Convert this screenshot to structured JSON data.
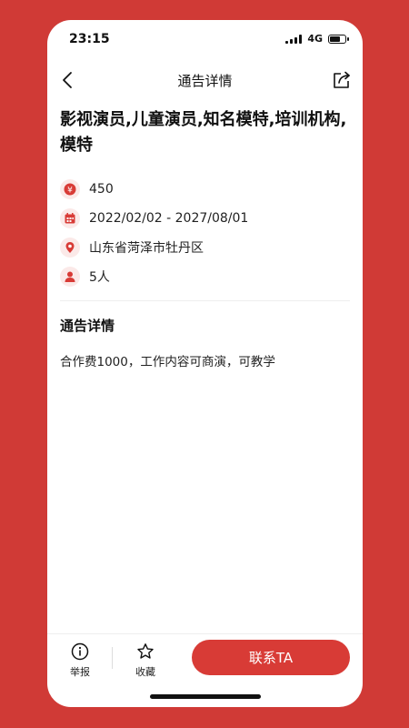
{
  "status_bar": {
    "time": "23:15",
    "network": "4G",
    "battery_level": 0.75
  },
  "navbar": {
    "title": "通告详情",
    "back_icon": "chevron-left-icon",
    "share_icon": "share-icon"
  },
  "notice": {
    "title": "影视演员,儿童演员,知名模特,培训机构,模特",
    "fee": "450",
    "date_range": "2022/02/02 - 2027/08/01",
    "location": "山东省菏泽市牡丹区",
    "headcount": "5人",
    "detail_heading": "通告详情",
    "detail_body": "合作费1000，工作内容可商演，可教学"
  },
  "bottom_bar": {
    "report_label": "举报",
    "favorite_label": "收藏",
    "contact_label": "联系TA"
  },
  "colors": {
    "accent": "#d83b36",
    "background": "#d03a36",
    "icon_bg": "#fbe9e8"
  }
}
